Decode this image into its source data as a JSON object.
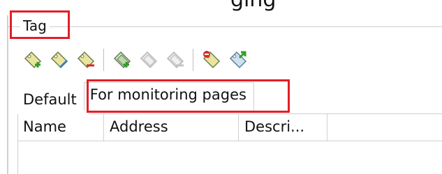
{
  "header": {
    "partial_title": "ging"
  },
  "group": {
    "legend": "Tag"
  },
  "toolbar": {
    "buttons": [
      {
        "icon": "tag-add-icon",
        "enabled": true
      },
      {
        "icon": "tag-edit-icon",
        "enabled": true
      },
      {
        "icon": "tag-delete-icon",
        "enabled": true
      },
      {
        "icon": "tag-add-group-icon",
        "enabled": true
      },
      {
        "icon": "tag-edit-group-icon",
        "enabled": false
      },
      {
        "icon": "tag-delete-group-icon",
        "enabled": false
      },
      {
        "icon": "tag-import-icon",
        "enabled": true
      },
      {
        "icon": "tag-export-icon",
        "enabled": true
      }
    ]
  },
  "tabs": [
    {
      "label": "Default",
      "active": false
    },
    {
      "label": "For monitoring pages",
      "active": true
    }
  ],
  "table": {
    "columns": [
      "Name",
      "Address",
      "Descri..."
    ],
    "rows": []
  },
  "colors": {
    "highlight": "#e11f26",
    "border": "#cfcfcf"
  }
}
